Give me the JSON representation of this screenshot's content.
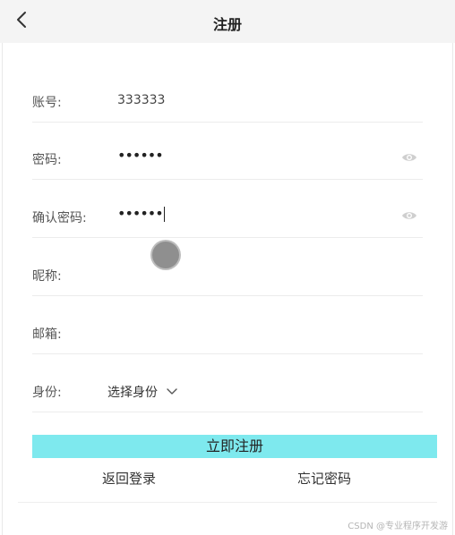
{
  "header": {
    "title": "注册",
    "back_icon": "chevron-left-icon"
  },
  "form": {
    "account": {
      "label": "账号:",
      "value": "333333"
    },
    "password": {
      "label": "密码:",
      "value": "••••••",
      "toggle_icon": "eye-icon"
    },
    "confirm_password": {
      "label": "确认密码:",
      "value": "••••••",
      "toggle_icon": "eye-icon"
    },
    "nickname": {
      "label": "昵称:",
      "value": ""
    },
    "email": {
      "label": "邮箱:",
      "value": ""
    },
    "identity": {
      "label": "身份:",
      "selected": "选择身份",
      "dropdown_icon": "chevron-down-icon"
    }
  },
  "actions": {
    "submit_label": "立即注册",
    "back_login_label": "返回登录",
    "forgot_password_label": "忘记密码"
  },
  "watermark": "CSDN @专业程序开发游",
  "colors": {
    "accent": "#7ee9ee",
    "header_bg": "#f4f4f4",
    "divider": "#ececec"
  }
}
